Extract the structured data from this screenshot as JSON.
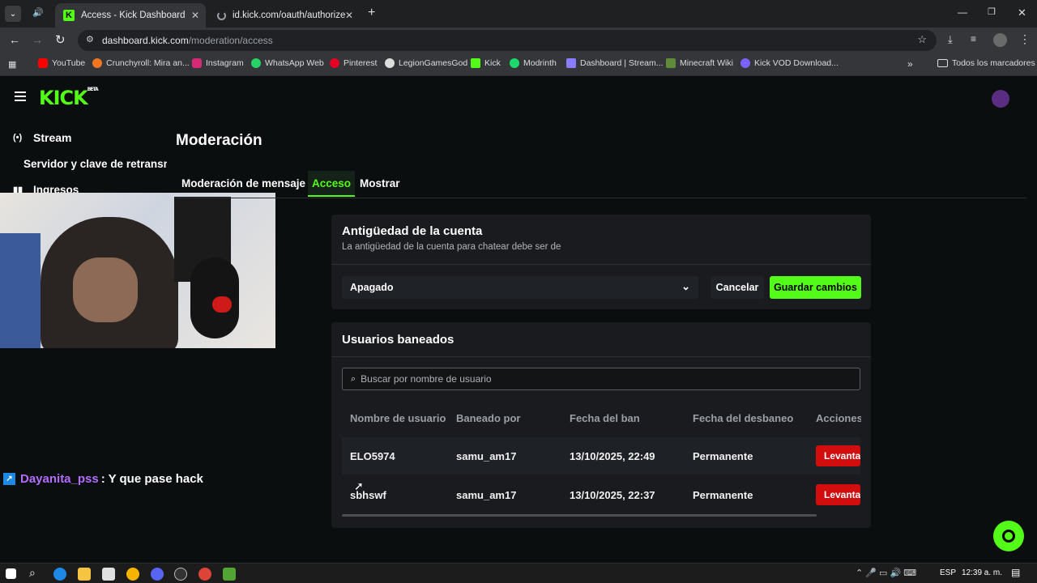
{
  "browser": {
    "tabs": [
      {
        "title": "Access - Kick Dashboard"
      },
      {
        "title": "id.kick.com/oauth/authorize?re"
      }
    ],
    "url_domain": "dashboard.kick.com",
    "url_path": "/moderation/access",
    "bookmarks": [
      "YouTube",
      "Crunchyroll: Mira an...",
      "Instagram",
      "WhatsApp Web",
      "Pinterest",
      "LegionGamesGod",
      "Kick",
      "Modrinth",
      "Dashboard | Stream...",
      "Minecraft Wiki",
      "Kick VOD Download..."
    ],
    "all_bookmarks": "Todos los marcadores"
  },
  "app": {
    "logo": "KICK",
    "logo_badge": "BETA",
    "accent": "#53fc18"
  },
  "sidebar": {
    "items": [
      {
        "label": "Stream",
        "icon": "broadcast-icon"
      },
      {
        "label": "Servidor y clave de retransm"
      },
      {
        "label": "Ingresos",
        "icon": "chart-icon"
      }
    ]
  },
  "main": {
    "title": "Moderación",
    "tabs": [
      {
        "label": "Moderación de mensaje"
      },
      {
        "label": "Acceso"
      },
      {
        "label": "Mostrar"
      }
    ],
    "account_age": {
      "title": "Antigüedad de la cuenta",
      "subtitle": "La antigüedad de la cuenta para chatear debe ser de",
      "select_value": "Apagado",
      "cancel": "Cancelar",
      "save": "Guardar cambios"
    },
    "banned": {
      "title": "Usuarios baneados",
      "search_placeholder": "Buscar por nombre de usuario",
      "columns": [
        "Nombre de usuario",
        "Baneado por",
        "Fecha del ban",
        "Fecha del desbaneo",
        "Acciones"
      ],
      "rows": [
        {
          "user": "ELO5974",
          "by": "samu_am17",
          "date": "13/10/2025, 22:49",
          "unban": "Permanente",
          "action": "Levantar"
        },
        {
          "user": "sbhswf",
          "by": "samu_am17",
          "date": "13/10/2025, 22:37",
          "unban": "Permanente",
          "action": "Levantar"
        }
      ]
    }
  },
  "overlay_chat": {
    "user": "Dayanita_pss",
    "message": ": Y que pase hack"
  },
  "taskbar": {
    "lang": "ESP",
    "time": "12:39 a. m."
  }
}
